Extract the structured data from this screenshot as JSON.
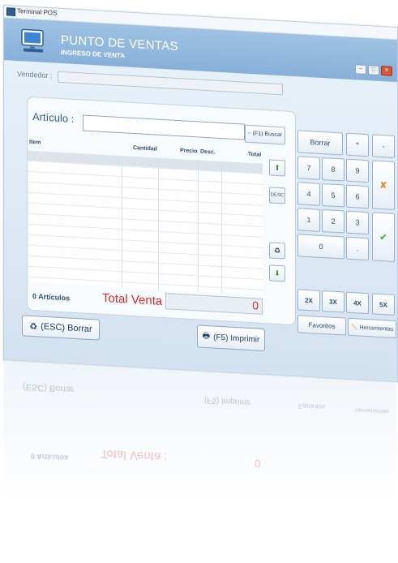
{
  "window": {
    "title": "Terminal POS"
  },
  "header": {
    "title": "PUNTO DE VENTAS",
    "subtitle": "INGRESO DE VENTA"
  },
  "vendedor": {
    "label": "Vendedor :",
    "value": ""
  },
  "articulo": {
    "label": "Artículo :",
    "value": "",
    "search_button": "(F1) Buscar"
  },
  "table": {
    "headers": [
      "Item",
      "Cantidad",
      "Precio",
      "Desc.",
      "Total"
    ],
    "rows": []
  },
  "side_buttons": {
    "desc_label": "DESC"
  },
  "footer": {
    "count_label": "0 Artículos",
    "total_label": "Total Venta :",
    "total_value": "0"
  },
  "keypad": {
    "borrar": "Borrar",
    "star": "*",
    "minus": "-",
    "keys": [
      "7",
      "8",
      "9",
      "4",
      "5",
      "6",
      "1",
      "2",
      "3"
    ],
    "zero": "0",
    "dot": ".",
    "multipliers": [
      "2X",
      "3X",
      "4X",
      "5X"
    ],
    "favoritos": "Favoritos",
    "herramientas": "Herramientas"
  },
  "actions": {
    "esc_borrar": "(ESC) Borrar",
    "f5_imprimir": "(F5) Imprimir"
  },
  "colors": {
    "accent": "#87b0d9",
    "total_red": "#d32a2a",
    "ok_green": "#4caf2a",
    "cancel_orange": "#e08a2a"
  }
}
